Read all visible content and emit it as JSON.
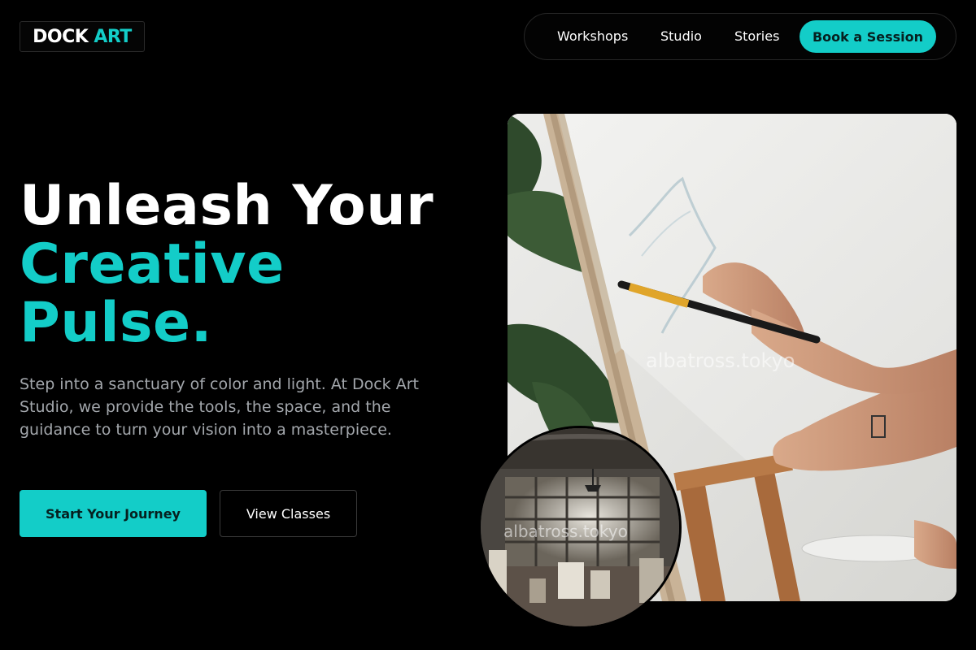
{
  "brand": {
    "name_part1": "DOCK",
    "name_part2": "ART",
    "accent_color": "#13cdc8"
  },
  "nav": {
    "links": [
      {
        "label": "Workshops"
      },
      {
        "label": "Studio"
      },
      {
        "label": "Stories"
      }
    ],
    "cta_label": "Book a Session"
  },
  "hero": {
    "title_line1": "Unleash Your",
    "title_line2": "Creative",
    "title_line3": "Pulse.",
    "description": "Step into a sanctuary of color and light. At Dock Art Studio, we provide the tools, the space, and the guidance to turn your vision into a masterpiece.",
    "primary_button": "Start Your Journey",
    "secondary_button": "View Classes"
  },
  "images": {
    "main_watermark": "albatross.tokyo",
    "circle_watermark": "albatross.tokyo"
  }
}
